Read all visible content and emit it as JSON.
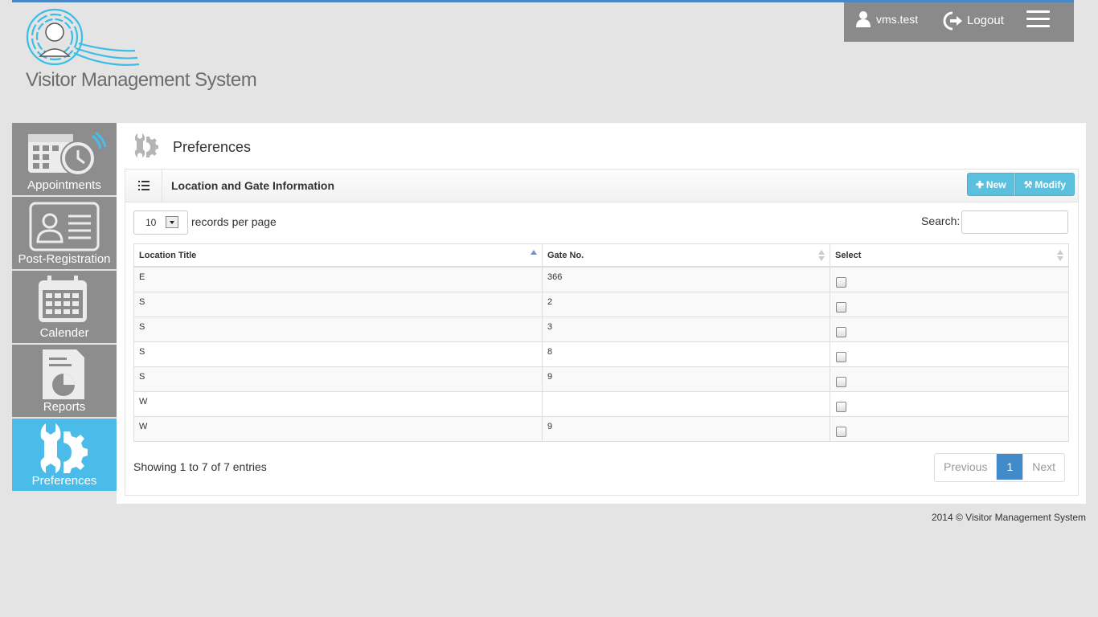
{
  "header": {
    "logo_text": "Visitor Management System",
    "user_name": "vms.test",
    "logout_label": "Logout"
  },
  "sidebar": {
    "items": [
      {
        "label": "Appointments",
        "icon": "calendar-clock-icon"
      },
      {
        "label": "Post-Registration",
        "icon": "id-card-icon"
      },
      {
        "label": "Calender",
        "icon": "calendar-icon"
      },
      {
        "label": "Reports",
        "icon": "report-chart-icon"
      },
      {
        "label": "Preferences",
        "icon": "wrench-gear-icon",
        "active": true
      }
    ]
  },
  "page": {
    "title": "Preferences",
    "box_title": "Location and Gate Information",
    "new_label": "New",
    "modify_label": "Modify",
    "length_value": "10",
    "length_label": "records per page",
    "search_label": "Search:",
    "search_value": ""
  },
  "table": {
    "columns": [
      "Location Title",
      "Gate No.",
      "Select"
    ],
    "rows": [
      {
        "location": "E",
        "gate": "366"
      },
      {
        "location": "S",
        "gate": "2"
      },
      {
        "location": "S",
        "gate": "3"
      },
      {
        "location": "S",
        "gate": "8"
      },
      {
        "location": "S",
        "gate": "9"
      },
      {
        "location": "W",
        "gate": ""
      },
      {
        "location": "W",
        "gate": "9"
      }
    ]
  },
  "pagination": {
    "info": "Showing 1 to 7 of 7 entries",
    "previous": "Previous",
    "current": "1",
    "next": "Next"
  },
  "footer": {
    "text": "2014 © Visitor Management System"
  },
  "colors": {
    "accent": "#4bbce9",
    "sidebar": "#8d8d8d",
    "button": "#5bc0de",
    "page_active": "#428bca"
  }
}
